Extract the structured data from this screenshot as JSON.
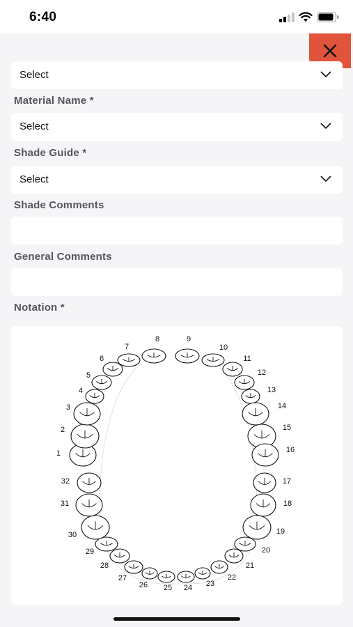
{
  "status_bar": {
    "time": "6:40"
  },
  "form": {
    "first_select_value": "Select",
    "material_label": "Material Name *",
    "material_value": "Select",
    "shade_guide_label": "Shade Guide *",
    "shade_guide_value": "Select",
    "shade_comments_label": "Shade Comments",
    "shade_comments_value": "",
    "general_comments_label": "General Comments",
    "general_comments_value": "",
    "notation_label": "Notation *"
  },
  "tooth_chart": {
    "numbers": [
      "1",
      "2",
      "3",
      "4",
      "5",
      "6",
      "7",
      "8",
      "9",
      "10",
      "11",
      "12",
      "13",
      "14",
      "15",
      "16",
      "17",
      "18",
      "19",
      "20",
      "21",
      "22",
      "23",
      "24",
      "25",
      "26",
      "27",
      "28",
      "29",
      "30",
      "31",
      "32"
    ]
  },
  "icons": {
    "close": "close-icon",
    "chevron": "chevron-down-icon"
  },
  "colors": {
    "close_button": "#e2533c",
    "sheet_background": "#f5f5f7"
  }
}
